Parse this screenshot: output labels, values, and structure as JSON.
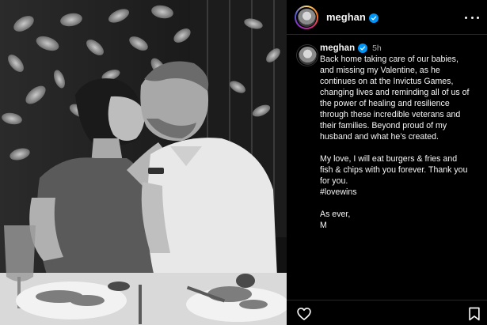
{
  "header": {
    "username": "meghan",
    "verified": true
  },
  "caption": {
    "username": "meghan",
    "time": "5h",
    "paragraphs": [
      "Back home taking care of our babies,\nand missing my Valentine, as he\ncontinues on at the Invictus Games,\nchanging lives and reminding all of us of\nthe power of healing and resilience\nthrough these incredible veterans and\ntheir families. Beyond proud of my\nhusband and what he’s created.",
      "My love, I will eat burgers & fries and\nfish & chips with you forever. Thank you\nfor you.\n#lovewins",
      "As ever,\nM"
    ]
  },
  "icons": {
    "header_avatar": "profile-avatar-icon",
    "verified": "verified-badge-icon",
    "more": "more-options-icon",
    "like": "heart-icon",
    "save": "bookmark-icon"
  },
  "colors": {
    "background": "#000000",
    "text": "#f5f5f5",
    "muted": "#a8a8a8",
    "verified": "#0095f6",
    "divider": "#262626"
  }
}
